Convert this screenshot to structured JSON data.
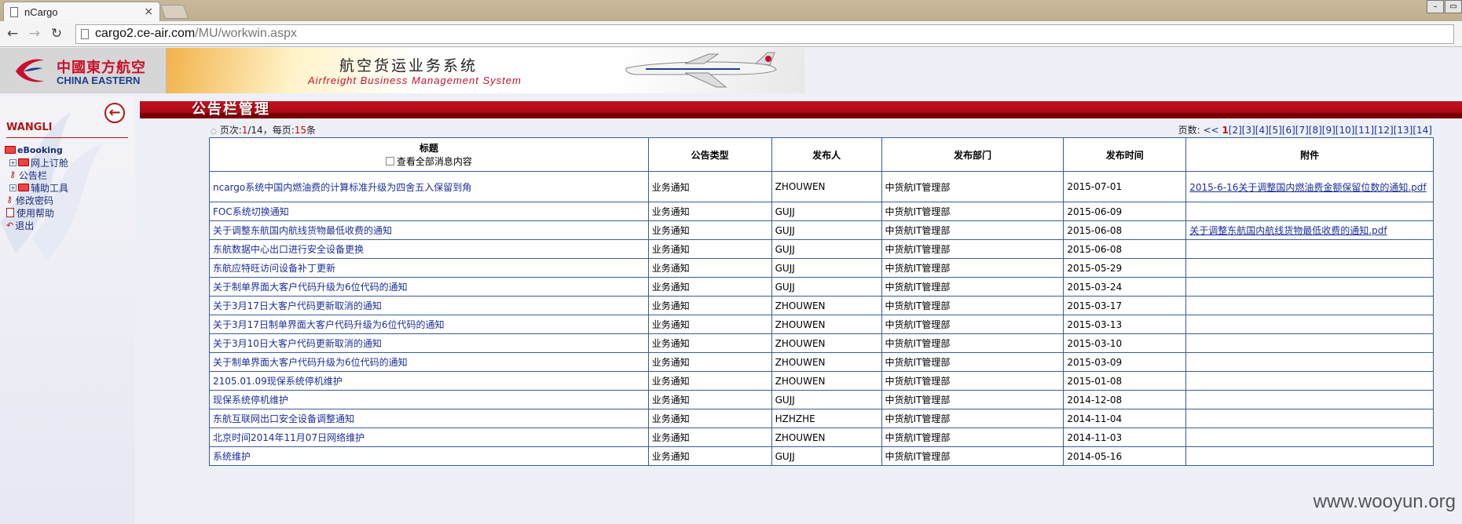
{
  "browser": {
    "tab_title": "nCargo",
    "close_glyph": "×",
    "url_host": "cargo2.ce-air.com",
    "url_path": "/MU/workwin.aspx"
  },
  "header": {
    "logo_cn": "中國東方航空",
    "logo_en": "CHINA EASTERN",
    "system_title_cn": "航空货运业务系统",
    "system_title_en": "Airfreight Business Management System",
    "brand_color": "#c8102e"
  },
  "sidebar": {
    "username": "WANGLI",
    "collapse_icon": "back-arrow-icon",
    "items": [
      {
        "label": "eBooking",
        "icon": "folder-icon"
      },
      {
        "label": "网上订舱",
        "icon": "folder-icon"
      },
      {
        "label": "公告栏",
        "icon": "key-icon"
      },
      {
        "label": "辅助工具",
        "icon": "folder-icon"
      },
      {
        "label": "修改密码",
        "icon": "key-icon"
      },
      {
        "label": "使用帮助",
        "icon": "help-icon"
      },
      {
        "label": "退出",
        "icon": "exit-icon"
      }
    ]
  },
  "main": {
    "section_title": "公告栏管理",
    "pager": {
      "info_prefix": "页次:",
      "current_page": "1",
      "info_total": "/14，每页:",
      "per_page": "15",
      "info_suffix": "条",
      "pages_label": "页数:",
      "prev": "<<",
      "current_link": "1",
      "pages": [
        "[2]",
        "[3]",
        "[4]",
        "[5]",
        "[6]",
        "[7]",
        "[8]",
        "[9]",
        "[10]",
        "[11]",
        "[12]",
        "[13]",
        "[14]"
      ]
    },
    "table": {
      "headers": {
        "title": "标题",
        "view_all": "查看全部消息内容",
        "type": "公告类型",
        "publisher": "发布人",
        "department": "发布部门",
        "time": "发布时间",
        "attachment": "附件"
      },
      "rows": [
        {
          "title": "ncargo系统中国内燃油费的计算标准升级为四舍五入保留到角",
          "type": "业务通知",
          "publisher": "ZHOUWEN",
          "department": "中货航IT管理部",
          "time": "2015-07-01",
          "attachment": "2015-6-16关于调整国内燃油费金额保留位数的通知.pdf"
        },
        {
          "title": "FOC系统切换通知",
          "type": "业务通知",
          "publisher": "GUJJ",
          "department": "中货航IT管理部",
          "time": "2015-06-09",
          "attachment": ""
        },
        {
          "title": "关于调整东航国内航线货物最低收费的通知",
          "type": "业务通知",
          "publisher": "GUJJ",
          "department": "中货航IT管理部",
          "time": "2015-06-08",
          "attachment": "关于调整东航国内航线货物最低收费的通知.pdf"
        },
        {
          "title": "东航数据中心出口进行安全设备更换",
          "type": "业务通知",
          "publisher": "GUJJ",
          "department": "中货航IT管理部",
          "time": "2015-06-08",
          "attachment": ""
        },
        {
          "title": "东航应特旺访问设备补丁更新",
          "type": "业务通知",
          "publisher": "GUJJ",
          "department": "中货航IT管理部",
          "time": "2015-05-29",
          "attachment": ""
        },
        {
          "title": "关于制单界面大客户代码升级为6位代码的通知",
          "type": "业务通知",
          "publisher": "GUJJ",
          "department": "中货航IT管理部",
          "time": "2015-03-24",
          "attachment": ""
        },
        {
          "title": "关于3月17日大客户代码更新取消的通知",
          "type": "业务通知",
          "publisher": "ZHOUWEN",
          "department": "中货航IT管理部",
          "time": "2015-03-17",
          "attachment": ""
        },
        {
          "title": "关于3月17日制单界面大客户代码升级为6位代码的通知",
          "type": "业务通知",
          "publisher": "ZHOUWEN",
          "department": "中货航IT管理部",
          "time": "2015-03-13",
          "attachment": ""
        },
        {
          "title": "关于3月10日大客户代码更新取消的通知",
          "type": "业务通知",
          "publisher": "ZHOUWEN",
          "department": "中货航IT管理部",
          "time": "2015-03-10",
          "attachment": ""
        },
        {
          "title": "关于制单界面大客户代码升级为6位代码的通知",
          "type": "业务通知",
          "publisher": "ZHOUWEN",
          "department": "中货航IT管理部",
          "time": "2015-03-09",
          "attachment": ""
        },
        {
          "title": "2105.01.09现保系统停机维护",
          "type": "业务通知",
          "publisher": "ZHOUWEN",
          "department": "中货航IT管理部",
          "time": "2015-01-08",
          "attachment": ""
        },
        {
          "title": "现保系统停机维护",
          "type": "业务通知",
          "publisher": "GUJJ",
          "department": "中货航IT管理部",
          "time": "2014-12-08",
          "attachment": ""
        },
        {
          "title": "东航互联网出口安全设备调整通知",
          "type": "业务通知",
          "publisher": "HZHZHE",
          "department": "中货航IT管理部",
          "time": "2014-11-04",
          "attachment": ""
        },
        {
          "title": "北京时间2014年11月07日网络维护",
          "type": "业务通知",
          "publisher": "ZHOUWEN",
          "department": "中货航IT管理部",
          "time": "2014-11-03",
          "attachment": ""
        },
        {
          "title": "系统维护",
          "type": "业务通知",
          "publisher": "GUJJ",
          "department": "中货航IT管理部",
          "time": "2014-05-16",
          "attachment": ""
        }
      ]
    }
  },
  "watermark": "www.wooyun.org"
}
